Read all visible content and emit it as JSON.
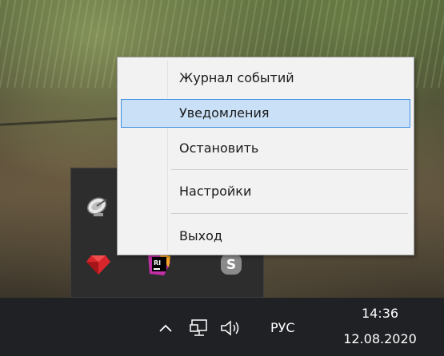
{
  "context_menu": {
    "items": [
      {
        "label": "Журнал событий",
        "highlighted": false
      },
      {
        "label": "Уведомления",
        "highlighted": true
      },
      {
        "label": "Остановить",
        "highlighted": false
      },
      {
        "label": "Настройки",
        "highlighted": false
      },
      {
        "label": "Выход",
        "highlighted": false
      }
    ],
    "highlight_color": "#c9e0f7",
    "highlight_border_color": "#3d8ee3"
  },
  "tray_flyout": {
    "icons": [
      "satellite-dish-icon",
      "ruby-icon",
      "rider-icon",
      "skype-icon"
    ],
    "skype_letter": "S",
    "rider_letters": "RI"
  },
  "taskbar": {
    "language": "РУС",
    "time": "14:36",
    "date": "12.08.2020",
    "icons": [
      "chevron-up-icon",
      "network-icon",
      "volume-icon"
    ]
  }
}
